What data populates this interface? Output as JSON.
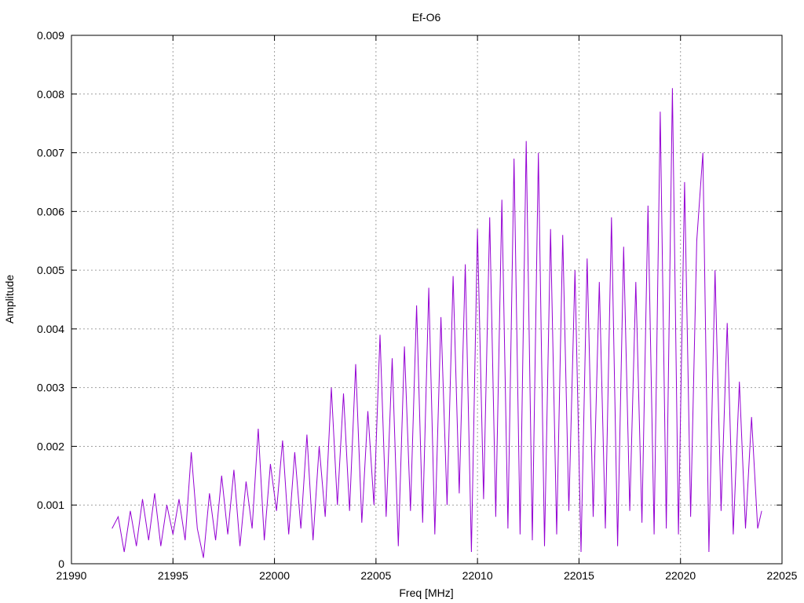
{
  "chart_data": {
    "type": "line",
    "title": "Ef-O6",
    "xlabel": "Freq [MHz]",
    "ylabel": "Amplitude",
    "xlim": [
      21990,
      22025
    ],
    "ylim": [
      0,
      0.009
    ],
    "x_ticks": [
      21990,
      21995,
      22000,
      22005,
      22010,
      22015,
      22020,
      22025
    ],
    "x_tick_labels": [
      "21990",
      "21995",
      "22000",
      "22005",
      "22010",
      "22015",
      "22020",
      "22025"
    ],
    "y_ticks": [
      0,
      0.001,
      0.002,
      0.003,
      0.004,
      0.005,
      0.006,
      0.007,
      0.008,
      0.009
    ],
    "y_tick_labels": [
      "0",
      "0.001",
      "0.002",
      "0.003",
      "0.004",
      "0.005",
      "0.006",
      "0.007",
      "0.008",
      "0.009"
    ],
    "grid": true,
    "legend": "none",
    "series": [
      {
        "color": "#9400d3",
        "x": [
          21992.0,
          21992.3,
          21992.6,
          21992.9,
          21993.2,
          21993.5,
          21993.8,
          21994.1,
          21994.4,
          21994.7,
          21995.0,
          21995.3,
          21995.6,
          21995.9,
          21996.2,
          21996.5,
          21996.8,
          21997.1,
          21997.4,
          21997.7,
          21998.0,
          21998.3,
          21998.6,
          21998.9,
          21999.2,
          21999.5,
          21999.8,
          22000.1,
          22000.4,
          22000.7,
          22001.0,
          22001.3,
          22001.6,
          22001.9,
          22002.2,
          22002.5,
          22002.8,
          22003.1,
          22003.4,
          22003.7,
          22004.0,
          22004.3,
          22004.6,
          22004.9,
          22005.2,
          22005.5,
          22005.8,
          22006.1,
          22006.4,
          22006.7,
          22007.0,
          22007.3,
          22007.6,
          22007.9,
          22008.2,
          22008.5,
          22008.8,
          22009.1,
          22009.4,
          22009.7,
          22010.0,
          22010.3,
          22010.6,
          22010.9,
          22011.2,
          22011.5,
          22011.8,
          22012.1,
          22012.4,
          22012.7,
          22013.0,
          22013.3,
          22013.6,
          22013.9,
          22014.2,
          22014.5,
          22014.8,
          22015.1,
          22015.4,
          22015.7,
          22016.0,
          22016.3,
          22016.6,
          22016.9,
          22017.2,
          22017.5,
          22017.8,
          22018.1,
          22018.4,
          22018.7,
          22019.0,
          22019.3,
          22019.6,
          22019.9,
          22020.2,
          22020.5,
          22020.8,
          22021.1,
          22021.4,
          22021.7,
          22022.0,
          22022.3,
          22022.6,
          22022.9,
          22023.2,
          22023.5,
          22023.8,
          22024.0
        ],
        "y": [
          0.0006,
          0.0008,
          0.0002,
          0.0009,
          0.0003,
          0.0011,
          0.0004,
          0.0012,
          0.0003,
          0.001,
          0.0005,
          0.0011,
          0.0004,
          0.0019,
          0.0006,
          0.0001,
          0.0012,
          0.0004,
          0.0015,
          0.0005,
          0.0016,
          0.0003,
          0.0014,
          0.0006,
          0.0023,
          0.0004,
          0.0017,
          0.0009,
          0.0021,
          0.0005,
          0.0019,
          0.0006,
          0.0022,
          0.0004,
          0.002,
          0.0008,
          0.003,
          0.001,
          0.0029,
          0.0009,
          0.0034,
          0.0007,
          0.0026,
          0.001,
          0.0039,
          0.0008,
          0.0035,
          0.0003,
          0.0037,
          0.0009,
          0.0044,
          0.0007,
          0.0047,
          0.0005,
          0.0042,
          0.001,
          0.0049,
          0.0012,
          0.0051,
          0.0002,
          0.0057,
          0.0011,
          0.0059,
          0.0008,
          0.0062,
          0.0006,
          0.0069,
          0.0005,
          0.0072,
          0.0004,
          0.007,
          0.0003,
          0.0057,
          0.0005,
          0.0056,
          0.0009,
          0.005,
          0.0002,
          0.0052,
          0.0008,
          0.0048,
          0.0006,
          0.0059,
          0.0003,
          0.0054,
          0.0009,
          0.0048,
          0.0007,
          0.0061,
          0.0005,
          0.0077,
          0.0006,
          0.0081,
          0.0005,
          0.0065,
          0.0008,
          0.0055,
          0.007,
          0.0002,
          0.005,
          0.0009,
          0.0041,
          0.0005,
          0.0031,
          0.0006,
          0.0025,
          0.0006,
          0.0009
        ]
      }
    ]
  }
}
